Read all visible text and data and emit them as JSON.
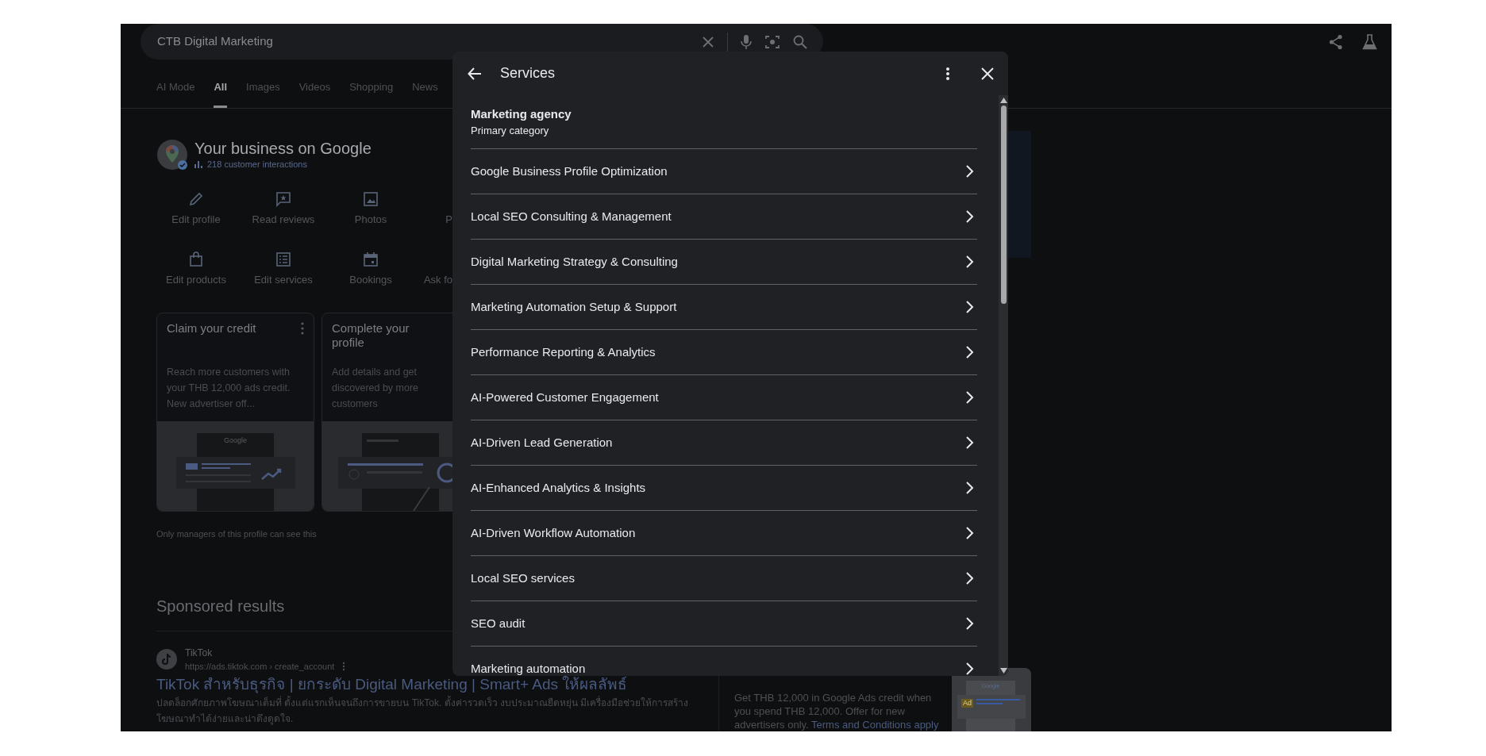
{
  "search": {
    "value": "CTB Digital Marketing"
  },
  "tabs": [
    {
      "label": "AI Mode",
      "selected": false
    },
    {
      "label": "All",
      "selected": true
    },
    {
      "label": "Images",
      "selected": false
    },
    {
      "label": "Videos",
      "selected": false
    },
    {
      "label": "Shopping",
      "selected": false
    },
    {
      "label": "News",
      "selected": false
    }
  ],
  "business": {
    "title": "Your business on Google",
    "interactions": "218 customer interactions"
  },
  "actions": [
    [
      {
        "label": "Edit profile",
        "kind": "pencil"
      },
      {
        "label": "Read reviews",
        "kind": "review"
      },
      {
        "label": "Photos",
        "kind": "photo"
      },
      {
        "label": "P"
      }
    ],
    [
      {
        "label": "Edit products",
        "kind": "bag"
      },
      {
        "label": "Edit services",
        "kind": "list"
      },
      {
        "label": "Bookings",
        "kind": "calendar"
      },
      {
        "label": "Ask fo"
      }
    ]
  ],
  "cards": [
    {
      "title": "Claim your credit",
      "text": "Reach more customers with your THB 12,000 ads credit. New advertiser off...",
      "menu": true,
      "kind": "ads",
      "illustration_label": "Google"
    },
    {
      "title": "Complete your profile",
      "text": "Add details and get discovered by more customers",
      "kind": "profile"
    }
  ],
  "cards_note": "Only managers of this profile can see this",
  "sponsored": {
    "heading": "Sponsored results",
    "advertiser": "TikTok",
    "url": "https://ads.tiktok.com › create_account",
    "title": "TikTok สำหรับธุรกิจ | ยกระดับ Digital Marketing | Smart+ Ads ให้ผลลัพธ์",
    "description": "ปลดล็อกศักยภาพโฆษณาเต็มที่ ตั้งแต่แรกเห็นจนถึงการขายบน TikTok. ตั้งค่ารวดเร็ว งบประมาณยืดหยุ่น มีเครื่องมือช่วยให้การสร้างโฆษณาทำได้ง่ายและน่าดึงดูดใจ."
  },
  "ad_offer": {
    "text": "Get THB 12,000 in Google Ads credit when you spend THB 12,000. Offer for new advertisers only.",
    "link": "Terms and Conditions apply",
    "image_logo": "Google",
    "image_badge": "Ad"
  },
  "dialog": {
    "title": "Services",
    "category": {
      "name": "Marketing agency",
      "label": "Primary category"
    },
    "services": [
      "Google Business Profile Optimization",
      "Local SEO Consulting & Management",
      "Digital Marketing Strategy & Consulting",
      "Marketing Automation Setup & Support",
      "Performance Reporting & Analytics",
      "AI-Powered Customer Engagement",
      "AI-Driven Lead Generation",
      "AI-Enhanced Analytics & Insights",
      "AI-Driven Workflow Automation",
      "Local SEO services",
      "SEO audit",
      "Marketing automation"
    ]
  }
}
